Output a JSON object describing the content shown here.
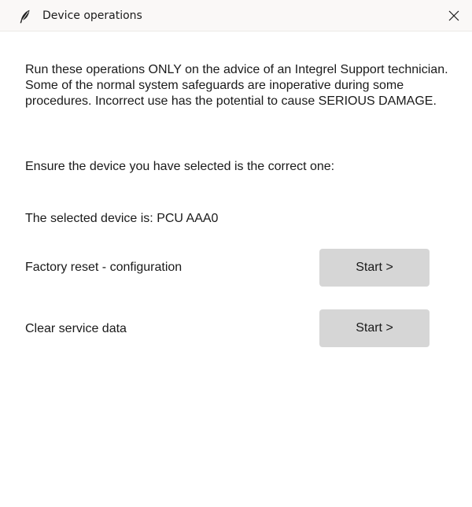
{
  "window": {
    "title": "Device operations",
    "app_icon": "feather-icon",
    "close_icon": "close-icon"
  },
  "main": {
    "warning_text": "Run these operations ONLY on the advice of an Integrel Support technician. Some of the normal system safeguards are inoperative during some procedures. Incorrect use has the potential to cause SERIOUS DAMAGE.",
    "instruction_text": "Ensure the device you have selected is the correct one:",
    "selected_device_text": "The selected device is: PCU AAA0",
    "operations": [
      {
        "label": "Factory reset - configuration",
        "button_label": "Start >"
      },
      {
        "label": "Clear service data",
        "button_label": "Start >"
      }
    ]
  },
  "colors": {
    "titlebar_bg": "#faf8f7",
    "button_bg": "#d6d6d6",
    "text": "#1a1a1a"
  }
}
